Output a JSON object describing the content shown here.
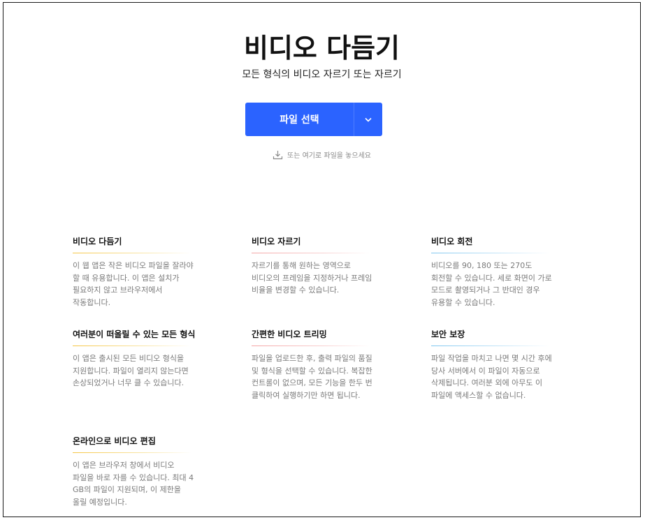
{
  "header": {
    "title": "비디오 다듬기",
    "subtitle": "모든 형식의 비디오 자르기 또는 자르기"
  },
  "upload": {
    "button_label": "파일 선택",
    "drop_hint": "또는 여기로 파일을 놓으세요",
    "caret_icon": "chevron-down-icon",
    "drop_icon": "download-icon"
  },
  "colors": {
    "accent": "#2b63ff",
    "rule_yellow": "#f5c542",
    "rule_pink": "#f4a4a4",
    "rule_blue": "#7ec6ef"
  },
  "features": [
    {
      "title": "비디오 다듬기",
      "text": "이 웹 앱은 작은 비디오 파일을 잘라야 할 때 유용합니다. 이 앱은 설치가 필요하지 않고 브라우저에서 작동합니다."
    },
    {
      "title": "비디오 자르기",
      "text": "자르기를 통해 원하는 영역으로 비디오의 프레임을 지정하거나 프레임 비율을 변경할 수 있습니다."
    },
    {
      "title": "비디오 회전",
      "text": "비디오를 90, 180 또는 270도 회전할 수 있습니다. 세로 화면이 가로 모드로 촬영되거나 그 반대인 경우 유용할 수 있습니다."
    },
    {
      "title": "여러분이 떠올릴 수 있는 모든 형식",
      "text": "이 앱은 출시된 모든 비디오 형식을 지원합니다. 파일이 열리지 않는다면 손상되었거나 너무 클 수 있습니다."
    },
    {
      "title": "간편한 비디오 트리밍",
      "text": "파일을 업로드한 후, 출력 파일의 품질 및 형식을 선택할 수 있습니다. 복잡한 컨트롤이 없으며, 모든 기능을 한두 번 클릭하여 실행하기만 하면 됩니다."
    },
    {
      "title": "보안 보장",
      "text": "파일 작업을 마치고 나면 몇 시간 후에 당사 서버에서 이 파일이 자동으로 삭제됩니다. 여러분 외에 아무도 이 파일에 액세스할 수 없습니다."
    },
    {
      "title": "온라인으로 비디오 편집",
      "text": "이 앱은 브라우저 창에서 비디오 파일을 바로 자를 수 있습니다. 최대 4 GB의 파일이 지원되며, 이 제한을 올릴 예정입니다."
    }
  ]
}
